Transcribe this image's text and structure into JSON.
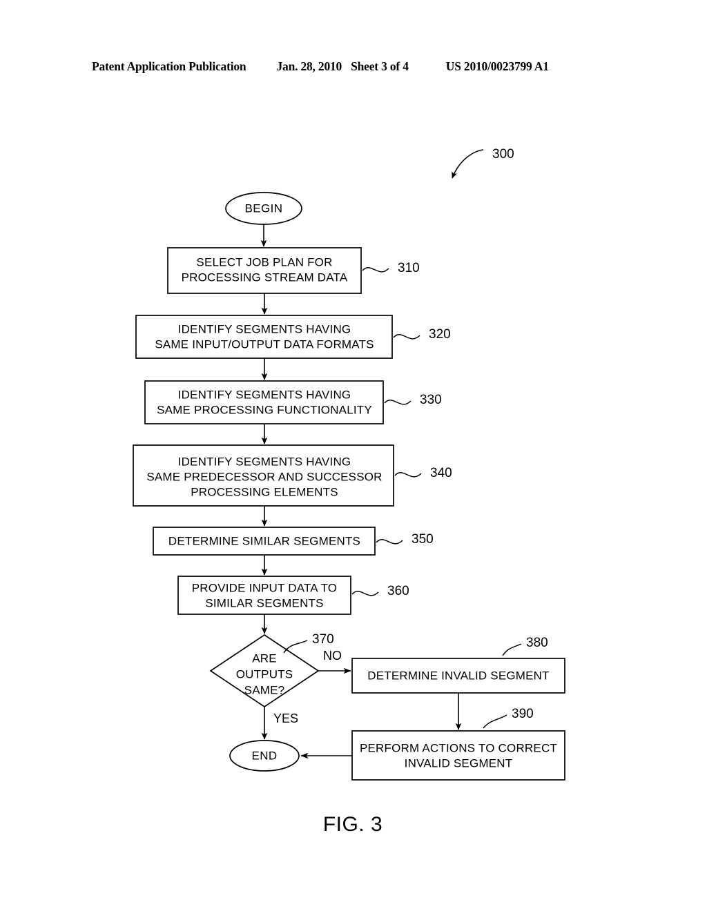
{
  "header": {
    "publication": "Patent Application Publication",
    "date": "Jan. 28, 2010",
    "sheet": "Sheet 3 of 4",
    "patent_number": "US 2010/0023799 A1"
  },
  "figure": {
    "caption": "FIG. 3",
    "figure_ref": "300",
    "start_label": "BEGIN",
    "end_label": "END",
    "branch_no": "NO",
    "branch_yes": "YES",
    "steps": [
      {
        "ref": "310",
        "line1": "SELECT JOB PLAN FOR",
        "line2": "PROCESSING STREAM DATA",
        "line3": ""
      },
      {
        "ref": "320",
        "line1": "IDENTIFY SEGMENTS HAVING",
        "line2": "SAME INPUT/OUTPUT DATA FORMATS",
        "line3": ""
      },
      {
        "ref": "330",
        "line1": "IDENTIFY SEGMENTS HAVING",
        "line2": "SAME PROCESSING FUNCTIONALITY",
        "line3": ""
      },
      {
        "ref": "340",
        "line1": "IDENTIFY SEGMENTS HAVING",
        "line2": "SAME PREDECESSOR AND SUCCESSOR",
        "line3": "PROCESSING ELEMENTS"
      },
      {
        "ref": "350",
        "line1": "DETERMINE SIMILAR SEGMENTS",
        "line2": "",
        "line3": ""
      },
      {
        "ref": "360",
        "line1": "PROVIDE INPUT DATA TO",
        "line2": "SIMILAR SEGMENTS",
        "line3": ""
      }
    ],
    "decision": {
      "ref": "370",
      "line1": "ARE",
      "line2": "OUTPUTS",
      "line3": "SAME?"
    },
    "branch_steps": [
      {
        "ref": "380",
        "line1": "DETERMINE INVALID SEGMENT",
        "line2": ""
      },
      {
        "ref": "390",
        "line1": "PERFORM ACTIONS TO CORRECT",
        "line2": "INVALID SEGMENT"
      }
    ]
  }
}
